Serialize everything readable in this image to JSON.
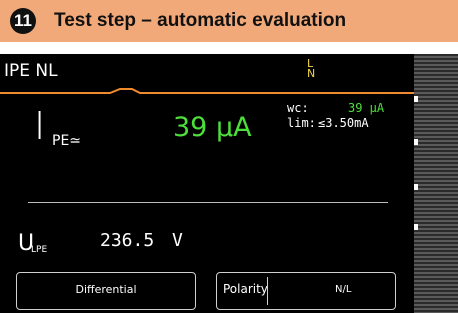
{
  "header": {
    "step_number": "11",
    "title": "Test step – automatic evaluation",
    "background": "#f2a97a"
  },
  "screen": {
    "title": "IPE NL",
    "connection_icon": {
      "name": "phase-neutral-connection-icon",
      "top": "L",
      "bottom": "N",
      "color": "#f1d54a"
    },
    "measurement": {
      "label": "I",
      "label_sub": "PE≃",
      "value": "39 µA",
      "value_color": "#4cdf3a",
      "wc_label": "wc:",
      "wc_value": "39 µA",
      "lim_label": "lim:",
      "lim_value": "≤3.50mA"
    },
    "voltage": {
      "label": "U",
      "label_sub": "LPE",
      "value": "236.5",
      "unit": "V"
    },
    "softkeys": {
      "differential": "Differential",
      "polarity_label": "Polarity",
      "polarity_value": "N/L"
    },
    "accent": "#f08a2e"
  }
}
